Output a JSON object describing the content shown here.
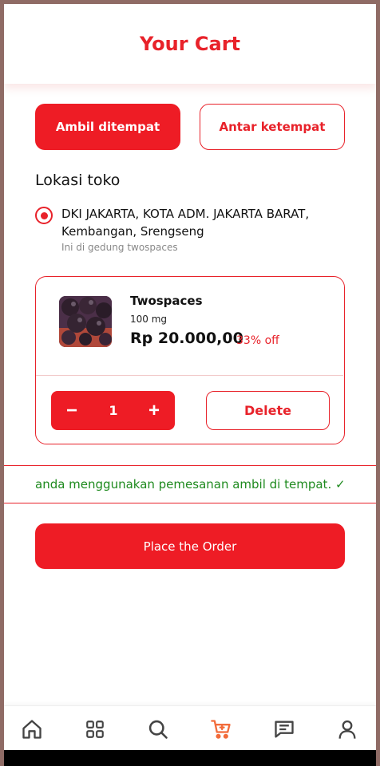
{
  "header": {
    "title": "Your Cart"
  },
  "mode_tabs": {
    "pickup_label": "Ambil ditempat",
    "delivery_label": "Antar ketempat"
  },
  "store": {
    "section_title": "Lokasi toko",
    "address": "DKI JAKARTA, KOTA ADM. JAKARTA BARAT, Kembangan, Srengseng",
    "note": "Ini di gedung twospaces"
  },
  "cart_item": {
    "name": "Twospaces",
    "weight": "100 mg",
    "price": "Rp 20.000,00",
    "discount": "33% off",
    "quantity": "1",
    "minus_label": "−",
    "plus_label": "+",
    "delete_label": "Delete"
  },
  "notice": "anda menggunakan pemesanan ambil di tempat. ✓",
  "place_order_label": "Place the Order",
  "bottom_nav": {
    "items": [
      "home-icon",
      "grid-icon",
      "search-icon",
      "cart-icon",
      "chat-icon",
      "profile-icon"
    ],
    "active": "cart-icon"
  },
  "colors": {
    "accent": "#ee1c25",
    "success": "#1e8a1e",
    "inactive_icon": "#444444",
    "active_icon": "#f26b3a"
  }
}
